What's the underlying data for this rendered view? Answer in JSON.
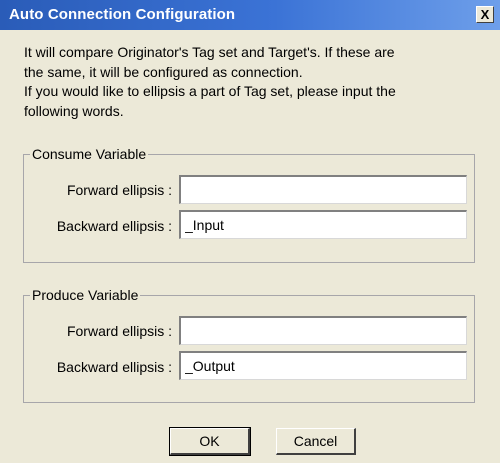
{
  "window": {
    "title": "Auto Connection Configuration",
    "close_label": "X"
  },
  "description": {
    "line1": "It will compare Originator's Tag set and Target's. If these are",
    "line2": "the same, it will be configured as connection.",
    "line3": "If you would like to ellipsis a part of Tag set, please input the",
    "line4": "following words."
  },
  "consume": {
    "legend": "Consume Variable",
    "forward_label": "Forward ellipsis :",
    "forward_value": "",
    "backward_label": "Backward ellipsis :",
    "backward_value": "_Input"
  },
  "produce": {
    "legend": "Produce Variable",
    "forward_label": "Forward ellipsis :",
    "forward_value": "",
    "backward_label": "Backward ellipsis :",
    "backward_value": "_Output"
  },
  "buttons": {
    "ok": "OK",
    "cancel": "Cancel"
  },
  "colors": {
    "title_bar": "#2a5cb8",
    "dialog_background": "#ece9d8"
  }
}
